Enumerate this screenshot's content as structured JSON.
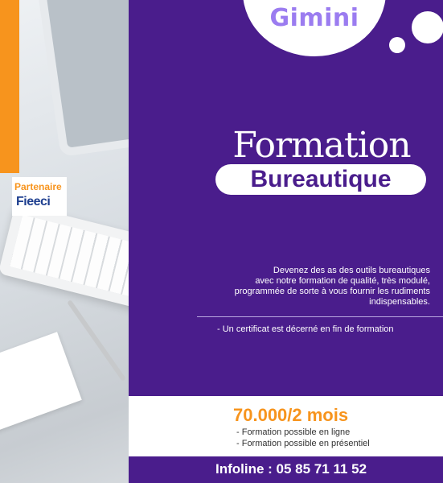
{
  "brand": {
    "name": "Gimini"
  },
  "partner": {
    "label": "Partenaire",
    "logo_text": "Fieeci"
  },
  "title": {
    "main": "Formation",
    "sub": "Bureautique"
  },
  "description": {
    "lines": [
      "Devenez des as des outils bureautiques",
      "avec notre formation de qualité, très modulé,",
      "programmée de sorte à vous fournir les rudiments",
      "indispensables."
    ]
  },
  "certificate": "- Un certificat est décerné en fin de formation",
  "pricing": {
    "price": "70.000/2 mois",
    "options": [
      "- Formation possible en ligne",
      "- Formation possible en présentiel"
    ]
  },
  "contact": {
    "infoline": "Infoline : 05 85 71 11 52"
  },
  "colors": {
    "purple": "#4a1d8c",
    "orange": "#f7941d",
    "brand_text": "#9b7cf0"
  }
}
